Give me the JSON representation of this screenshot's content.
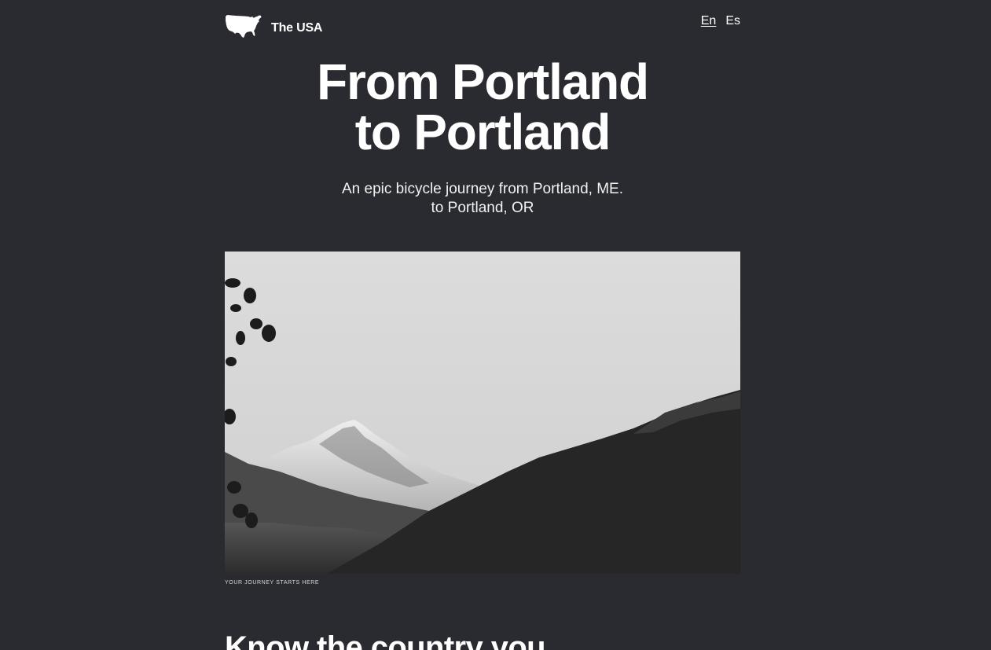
{
  "header": {
    "logo_text": "The USA",
    "languages": [
      {
        "label": "En",
        "active": true
      },
      {
        "label": "Es",
        "active": false
      }
    ]
  },
  "hero": {
    "title_line1": "From Portland",
    "title_line2": "to Portland",
    "subtitle_line1": "An epic bicycle journey from Portland, ME.",
    "subtitle_line2": "to Portland, OR"
  },
  "photo": {
    "caption": "YOUR JOURNEY STARTS HERE"
  },
  "section": {
    "heading": "Know the country you"
  },
  "colors": {
    "background": "#2a2b30",
    "text": "#ffffff"
  },
  "icons": {
    "logo": "usa-map-icon"
  }
}
